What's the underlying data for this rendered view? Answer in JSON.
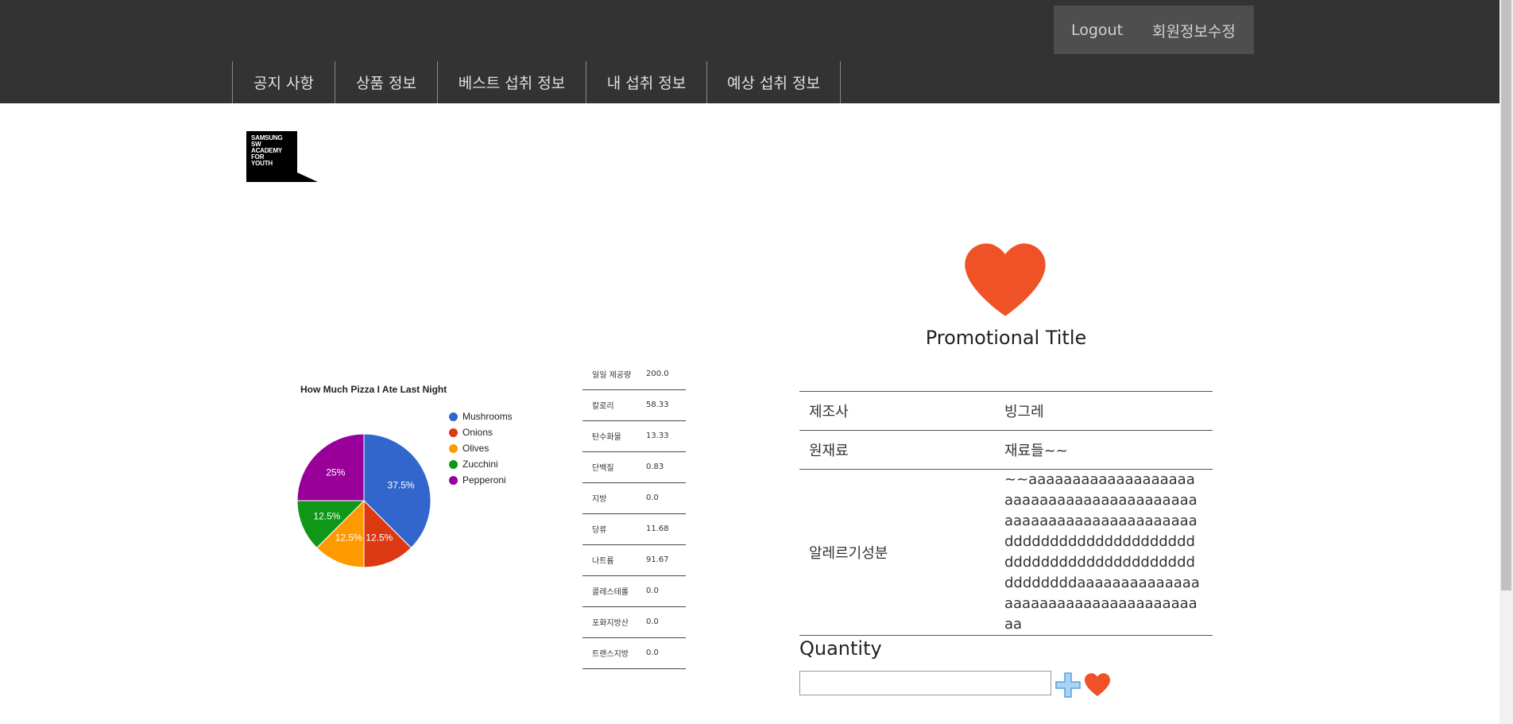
{
  "header": {
    "account": {
      "logout_label": "Logout",
      "edit_label": "회원정보수정"
    },
    "nav": [
      {
        "label": "공지 사항"
      },
      {
        "label": "상품 정보"
      },
      {
        "label": "베스트 섭취 정보"
      },
      {
        "label": "내 섭취 정보"
      },
      {
        "label": "예상 섭취 정보"
      }
    ]
  },
  "logo": {
    "text": "SAMSUNG\nSW\nACADEMY\nFOR\nYOUTH"
  },
  "chart_data": {
    "type": "pie",
    "title": "How Much Pizza I Ate Last Night",
    "categories": [
      "Mushrooms",
      "Onions",
      "Olives",
      "Zucchini",
      "Pepperoni"
    ],
    "values": [
      37.5,
      12.5,
      12.5,
      12.5,
      25
    ],
    "labels": [
      "37.5%",
      "12.5%",
      "12.5%",
      "12.5%",
      "25%"
    ],
    "colors": [
      "#3366cc",
      "#dc3912",
      "#ff9900",
      "#109618",
      "#990099"
    ],
    "legend_position": "right"
  },
  "nutrition": [
    {
      "label": "일일 제공량",
      "value": "200.0"
    },
    {
      "label": "칼로리",
      "value": "58.33"
    },
    {
      "label": "탄수화물",
      "value": "13.33"
    },
    {
      "label": "단백질",
      "value": "0.83"
    },
    {
      "label": "지방",
      "value": "0.0"
    },
    {
      "label": "당류",
      "value": "11.68"
    },
    {
      "label": "나트륨",
      "value": "91.67"
    },
    {
      "label": "콜레스테롤",
      "value": "0.0"
    },
    {
      "label": "포화지방산",
      "value": "0.0"
    },
    {
      "label": "트랜스지방",
      "value": "0.0"
    }
  ],
  "product": {
    "title": "Promotional Title",
    "heart_color": "#f05228",
    "info": [
      {
        "key": "제조사",
        "value": "빙그레"
      },
      {
        "key": "원재료",
        "value": "재료들~~"
      },
      {
        "key": "알레르기성분",
        "value": "~~aaaaaaaaaaaaaaaaaaaaaaaaaaaaaaaaaaaaaaaaaaaaaaaaaaaaaaaaaaaaaaaddddddddddddddddddddddddddddddddddddddddddddddddddaaaaaaaaaaaaaaaaaaaaaaaaaaaaaaaaaaaaaa"
      }
    ],
    "quantity_label": "Quantity",
    "quantity_value": ""
  },
  "icons": {
    "plus": "plus-icon",
    "heart": "heart-icon"
  },
  "colors": {
    "header_bg": "#333333",
    "account_bg": "#4e4e4e",
    "accent_heart": "#f05228",
    "plus_blue": "#6fb4ee"
  }
}
